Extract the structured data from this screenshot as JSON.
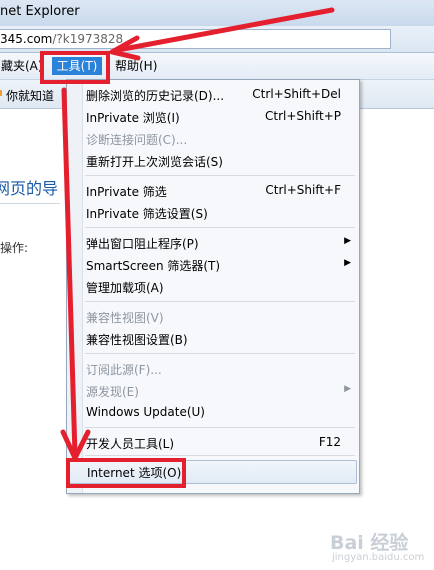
{
  "window": {
    "title": "net Explorer",
    "url_host": "345.com",
    "url_path": "/?k1973828"
  },
  "menubar": {
    "favorites": "藏夹(A)",
    "tools": "工具(T)",
    "help": "帮助(H)"
  },
  "favbar": {
    "text": "你就知道"
  },
  "page": {
    "heading": "网页的导",
    "label": "操作:"
  },
  "tools_menu": {
    "items": [
      {
        "label": "删除浏览的历史记录(D)...",
        "shortcut": "Ctrl+Shift+Del",
        "disabled": false
      },
      {
        "label": "InPrivate 浏览(I)",
        "shortcut": "Ctrl+Shift+P",
        "disabled": false
      },
      {
        "label": "诊断连接问题(C)...",
        "shortcut": "",
        "disabled": true
      },
      {
        "label": "重新打开上次浏览会话(S)",
        "shortcut": "",
        "disabled": false
      },
      {
        "label": "InPrivate 筛选",
        "shortcut": "Ctrl+Shift+F",
        "disabled": false
      },
      {
        "label": "InPrivate 筛选设置(S)",
        "shortcut": "",
        "disabled": false
      },
      {
        "label": "弹出窗口阻止程序(P)",
        "shortcut": "",
        "disabled": false,
        "submenu": true
      },
      {
        "label": "SmartScreen 筛选器(T)",
        "shortcut": "",
        "disabled": false,
        "submenu": true
      },
      {
        "label": "管理加载项(A)",
        "shortcut": "",
        "disabled": false
      },
      {
        "label": "兼容性视图(V)",
        "shortcut": "",
        "disabled": true
      },
      {
        "label": "兼容性视图设置(B)",
        "shortcut": "",
        "disabled": false
      },
      {
        "label": "订阅此源(F)...",
        "shortcut": "",
        "disabled": true
      },
      {
        "label": "源发现(E)",
        "shortcut": "",
        "disabled": true,
        "submenu": true
      },
      {
        "label": "Windows Update(U)",
        "shortcut": "",
        "disabled": false
      },
      {
        "label": "开发人员工具(L)",
        "shortcut": "F12",
        "disabled": false
      },
      {
        "label": "Internet 选项(O)",
        "shortcut": "",
        "disabled": false,
        "hovered": true
      }
    ],
    "submenu_arrow": "▶"
  },
  "watermark": {
    "brand": "Bai 经验",
    "url": "jingyan.baidu.com"
  },
  "colors": {
    "annotation": "#e5202e",
    "menu_highlight": "#2b82d9"
  }
}
